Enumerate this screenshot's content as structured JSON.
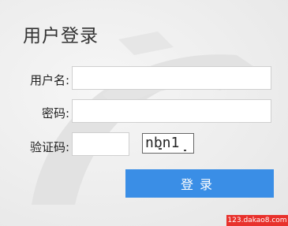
{
  "login": {
    "title": "用户登录",
    "username_label": "用户名:",
    "username_value": "",
    "password_label": "密码:",
    "password_value": "",
    "captcha_label": "验证码:",
    "captcha_value": "",
    "captcha_text": "nbn1",
    "submit_label": "登录"
  },
  "watermark": "123.dakao8.com",
  "colors": {
    "button": "#3a8ee6",
    "watermark_bg": "#e8312c"
  }
}
